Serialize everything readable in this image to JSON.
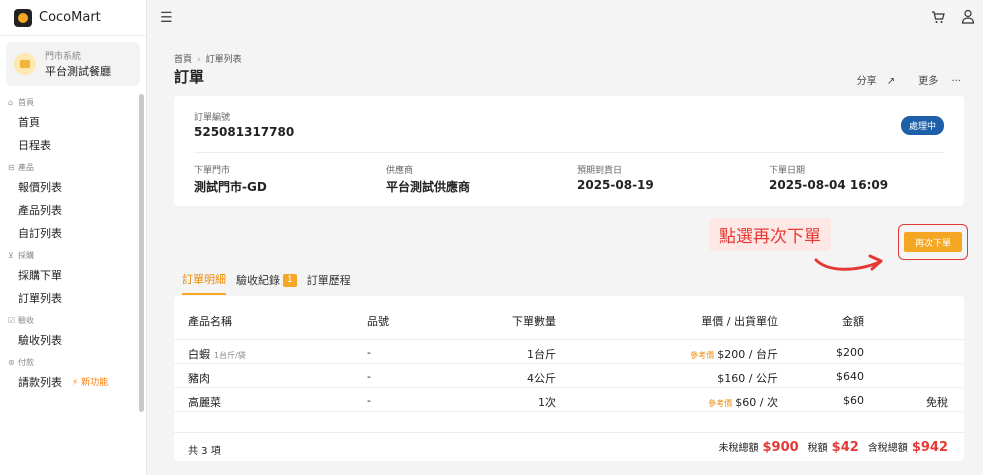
{
  "app": {
    "name": "CocoMart"
  },
  "store": {
    "subtitle": "門市系統",
    "name": "平台測試餐廳"
  },
  "sidebar": {
    "groups": [
      {
        "label": "首頁",
        "icon": "home-icon",
        "items": [
          "首頁",
          "日程表"
        ]
      },
      {
        "label": "產品",
        "icon": "box-icon",
        "items": [
          "報價列表",
          "產品列表",
          "自訂列表"
        ]
      },
      {
        "label": "採購",
        "icon": "cart-icon",
        "items": [
          "採購下單",
          "訂單列表"
        ]
      },
      {
        "label": "驗收",
        "icon": "check-icon",
        "items": [
          "驗收列表"
        ]
      },
      {
        "label": "付款",
        "icon": "dollar-icon",
        "items": [
          "請款列表"
        ]
      }
    ],
    "new_badge": "⚡ 新功能"
  },
  "breadcrumb": {
    "home": "首頁",
    "current": "訂單列表"
  },
  "page": {
    "title": "訂單",
    "share": "分享",
    "more": "更多"
  },
  "order": {
    "id_label": "訂單編號",
    "id": "525081317780",
    "status": "處理中",
    "store_label": "下單門市",
    "store": "測試門市-GD",
    "supplier_label": "供應商",
    "supplier": "平台測試供應商",
    "expected_label": "預期到貨日",
    "expected": "2025-08-19",
    "order_date_label": "下單日期",
    "order_date": "2025-08-04 16:09"
  },
  "annotation": {
    "text": "點選再次下單"
  },
  "reorder_button": "再次下單",
  "tabs": [
    {
      "label": "訂單明細",
      "active": true
    },
    {
      "label": "驗收紀錄",
      "count": "1"
    },
    {
      "label": "訂單歷程"
    }
  ],
  "table": {
    "headers": [
      "產品名稱",
      "品號",
      "下單數量",
      "單價 / 出貨單位",
      "金額"
    ],
    "rows": [
      {
        "name": "白蝦",
        "unit_tag": "1台斤/袋",
        "sku": "-",
        "qty": "1台斤",
        "ref": "參考價",
        "price": "$200 / 台斤",
        "amount": "$200",
        "note": ""
      },
      {
        "name": "豬肉",
        "unit_tag": "",
        "sku": "-",
        "qty": "4公斤",
        "ref": "",
        "price": "$160 / 公斤",
        "amount": "$640",
        "note": ""
      },
      {
        "name": "高麗菜",
        "unit_tag": "",
        "sku": "-",
        "qty": "1次",
        "ref": "參考價",
        "price": "$60 / 次",
        "amount": "$60",
        "note": "免稅"
      }
    ],
    "total_count": "共 3 項",
    "subtotal_label": "未稅總額",
    "subtotal": "$900",
    "tax_label": "稅額",
    "tax": "$42",
    "total_label": "含稅總額",
    "total": "$942"
  },
  "colors": {
    "accent": "#f5a623",
    "status": "#1d5fa8",
    "highlight": "#e53935"
  }
}
